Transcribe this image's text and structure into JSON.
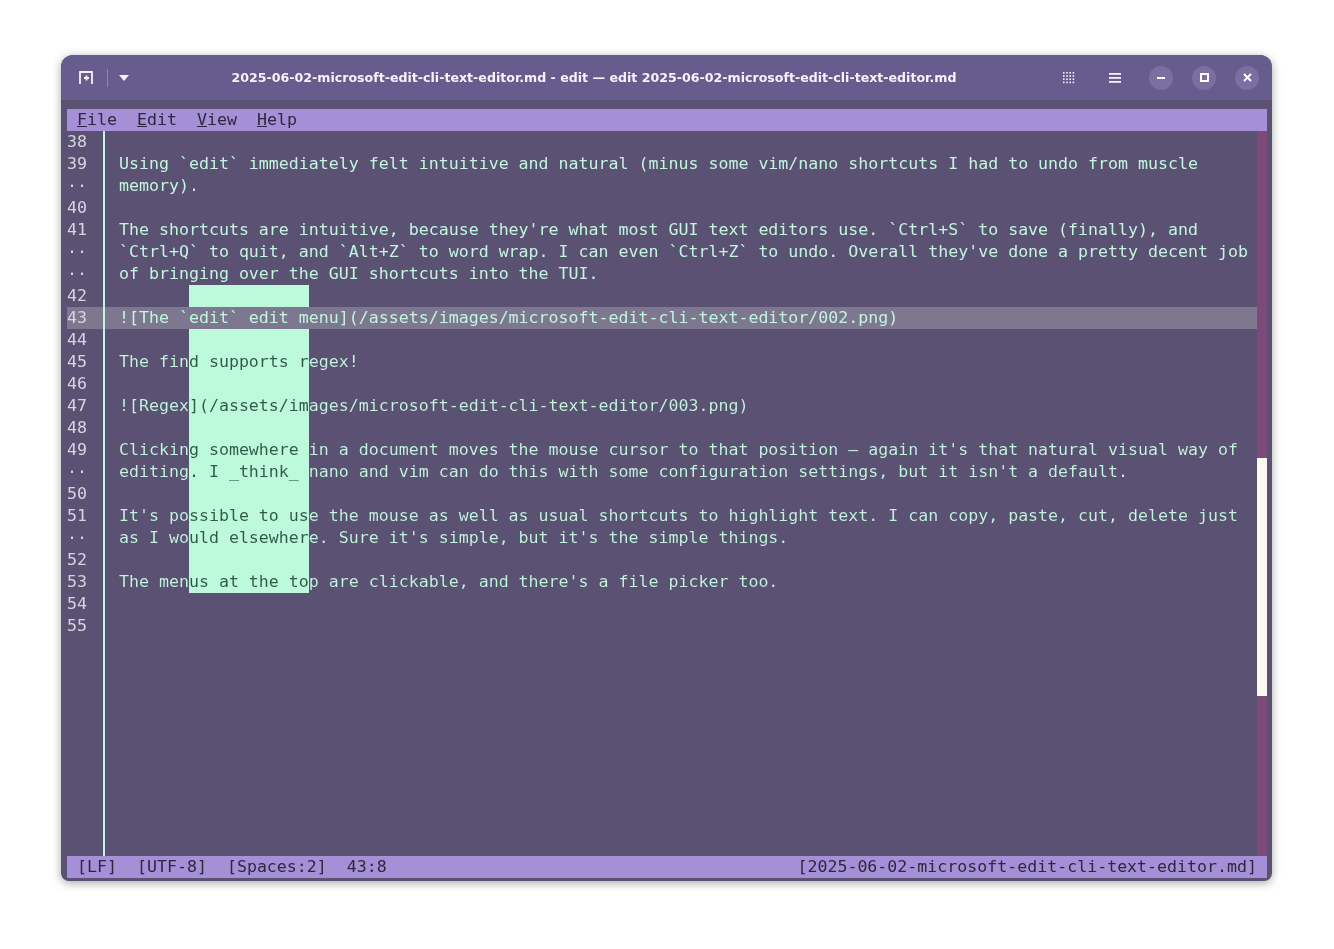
{
  "window": {
    "title": "2025-06-02-microsoft-edit-cli-text-editor.md - edit — edit 2025-06-02-microsoft-edit-cli-text-editor.md"
  },
  "menu": [
    {
      "label": "File"
    },
    {
      "label": "Edit"
    },
    {
      "label": "View"
    },
    {
      "label": "Help"
    }
  ],
  "lines": [
    {
      "number": "38",
      "current": false
    },
    {
      "number": "39",
      "text": "Using `edit` immediately felt intuitive and natural (minus some vim/nano shortcuts I had to undo from muscle",
      "current": false
    },
    {
      "number": "··",
      "text": "memory).",
      "current": false
    },
    {
      "number": "40",
      "current": false
    },
    {
      "number": "41",
      "text": "The shortcuts are intuitive, because they're what most GUI text editors use. `Ctrl+S` to save (finally), and",
      "current": false
    },
    {
      "number": "··",
      "text": "`Ctrl+Q` to quit, and `Alt+Z` to word wrap. I can even `Ctrl+Z` to undo. Overall they've done a pretty decent job",
      "current": false
    },
    {
      "number": "··",
      "text": "of bringing over the GUI shortcuts into the TUI.",
      "current": false
    },
    {
      "number": "42",
      "current": false
    },
    {
      "number": "43",
      "text": "![The `edit` edit menu](/assets/images/microsoft-edit-cli-text-editor/002.png)",
      "current": true
    },
    {
      "number": "44",
      "current": false
    },
    {
      "number": "45",
      "text": "The find supports regex!",
      "current": false
    },
    {
      "number": "46",
      "current": false
    },
    {
      "number": "47",
      "text": "![Regex](/assets/images/microsoft-edit-cli-text-editor/003.png)",
      "current": false
    },
    {
      "number": "48",
      "current": false
    },
    {
      "number": "49",
      "text": "Clicking somewhere in a document moves the mouse cursor to that position — again it's that natural visual way of",
      "current": false
    },
    {
      "number": "··",
      "text": "editing. I _think_ nano and vim can do this with some configuration settings, but it isn't a default.",
      "current": false
    },
    {
      "number": "50",
      "current": false
    },
    {
      "number": "51",
      "text": "It's possible to use the mouse as well as usual shortcuts to highlight text. I can copy, paste, cut, delete just",
      "current": false
    },
    {
      "number": "··",
      "text": "as I would elsewhere. Sure it's simple, but it's the simple things.",
      "current": false
    },
    {
      "number": "52",
      "current": false
    },
    {
      "number": "53",
      "text": "The menus at the top are clickable, and there's a file picker too.",
      "current": false
    },
    {
      "number": "54",
      "current": false
    },
    {
      "number": "55",
      "current": false
    }
  ],
  "status_bar": {
    "items": [
      "[LF]",
      "[UTF-8]",
      "[Spaces:2]",
      "43:8"
    ],
    "file": "[2025-06-02-microsoft-edit-cli-text-editor.md]"
  }
}
